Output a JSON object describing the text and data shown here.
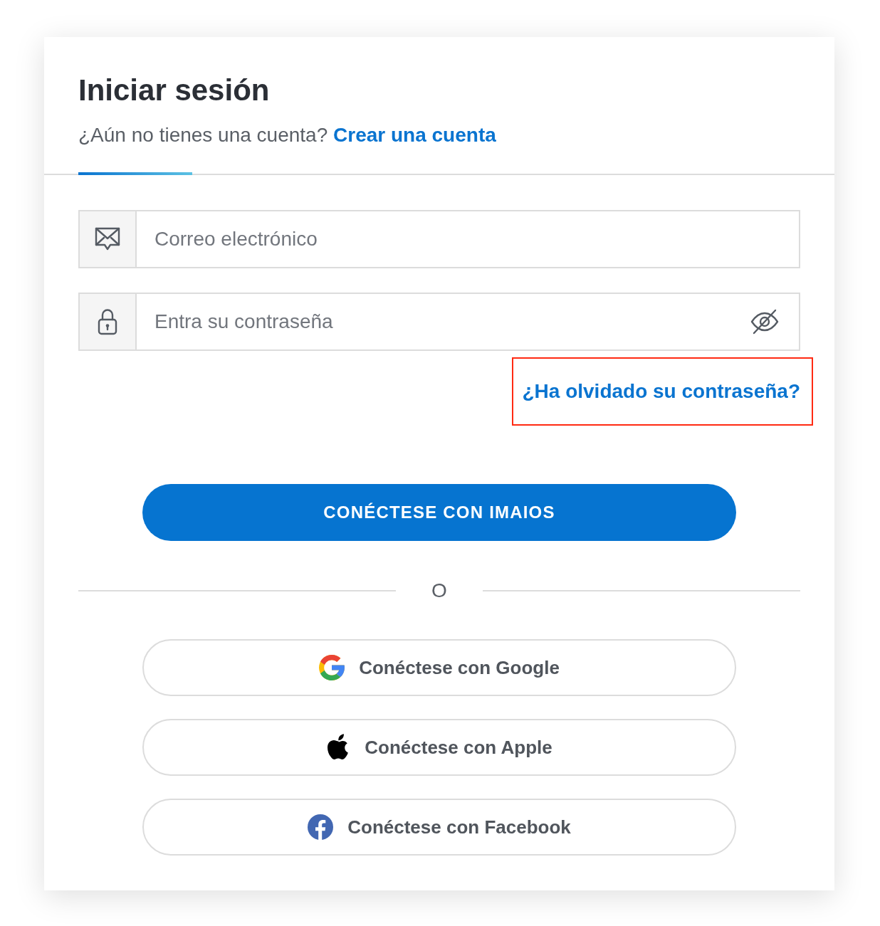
{
  "header": {
    "title": "Iniciar sesión",
    "prompt": "¿Aún no tienes una cuenta?",
    "signup_link": "Crear una cuenta"
  },
  "fields": [
    {
      "kind": "email",
      "placeholder": "Correo electrónico"
    },
    {
      "kind": "password",
      "placeholder": "Entra su contraseña"
    }
  ],
  "forgot_link": {
    "label": "¿Ha olvidado su contraseña?",
    "highlighted": true
  },
  "primary_button": "CONÉCTESE CON IMAIOS",
  "separator": "O",
  "social_buttons": [
    {
      "kind": "google",
      "label": "Conéctese con Google"
    },
    {
      "kind": "apple",
      "label": "Conéctese con Apple"
    },
    {
      "kind": "facebook",
      "label": "Conéctese con Facebook"
    }
  ]
}
